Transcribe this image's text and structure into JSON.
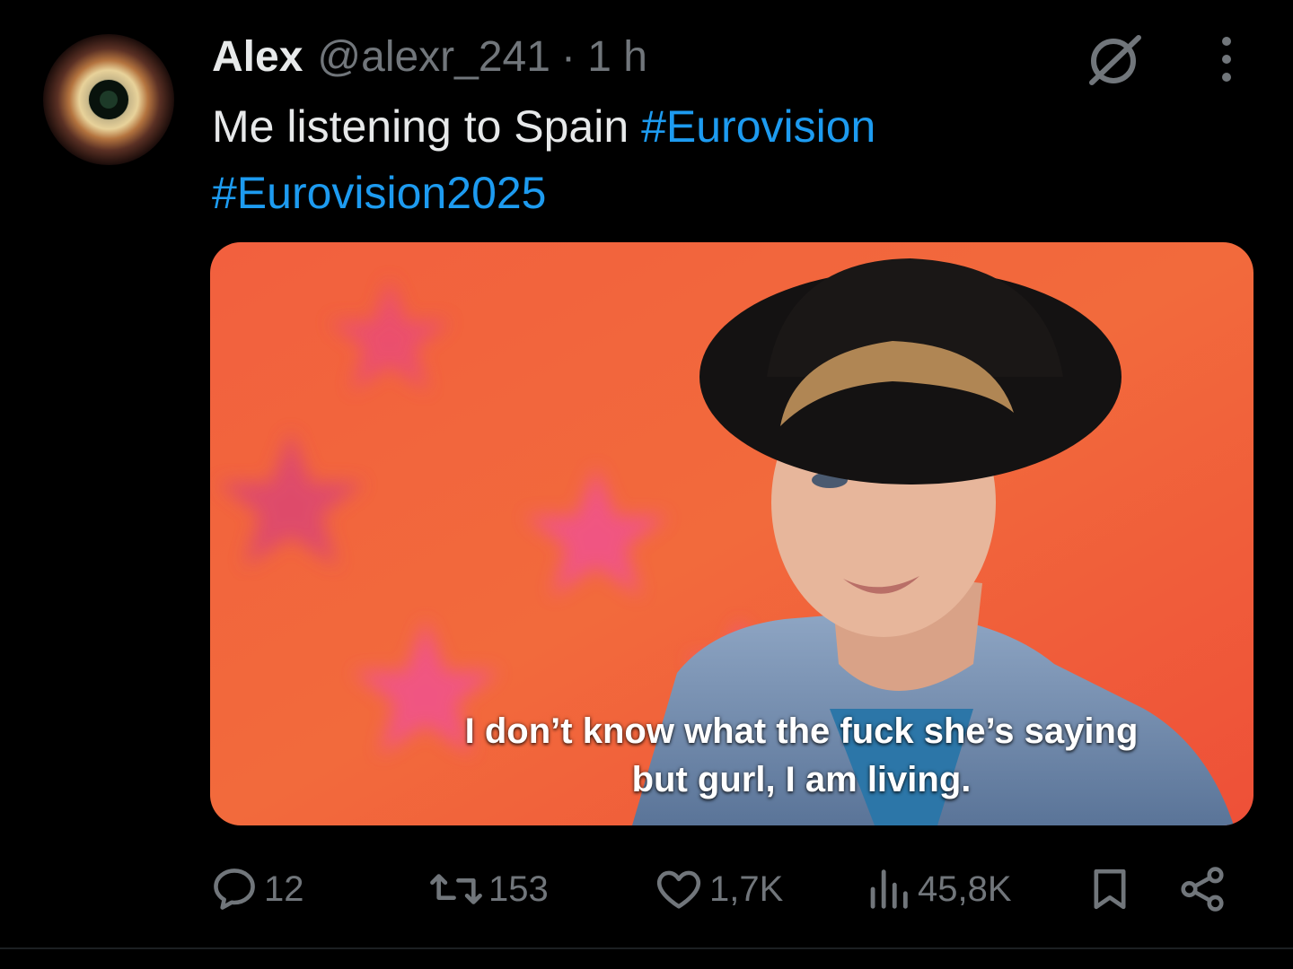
{
  "tweet": {
    "author_name": "Alex",
    "handle": "@alexr_241",
    "time": "· 1 h",
    "text": "Me listening to Spain",
    "hashtags": [
      "#Eurovision",
      "#Eurovision2025"
    ]
  },
  "media": {
    "caption_line1": "I don’t know what the fuck she’s saying",
    "caption_line2": "but gurl, I am living."
  },
  "actions": {
    "replies": "12",
    "reposts": "153",
    "likes": "1,7K",
    "views": "45,8K"
  },
  "icons": {
    "grok": "grok-icon",
    "more": "more-vertical-icon",
    "reply": "reply-icon",
    "repost": "repost-icon",
    "like": "heart-icon",
    "views": "views-icon",
    "bookmark": "bookmark-icon",
    "share": "share-icon"
  },
  "colors": {
    "background": "#000000",
    "text": "#e7e9ea",
    "secondary": "#71767b",
    "hashtag": "#1d9bf0"
  }
}
